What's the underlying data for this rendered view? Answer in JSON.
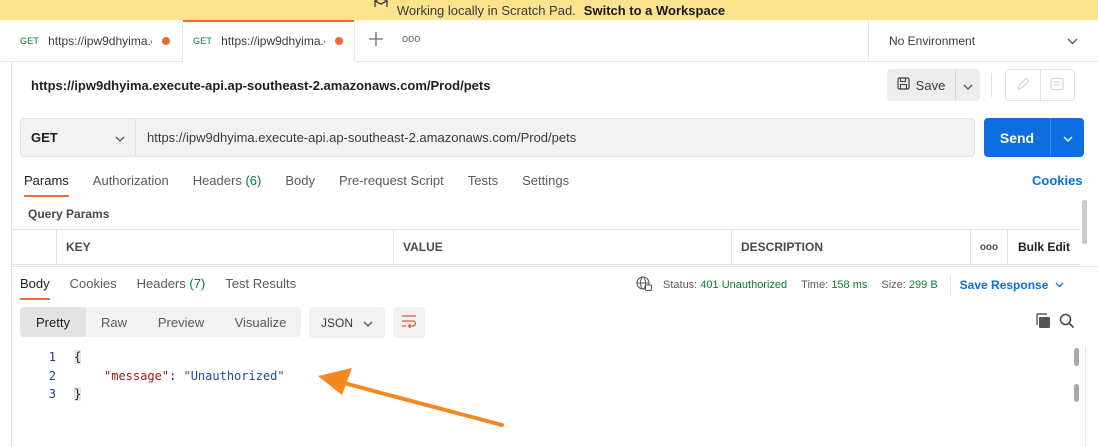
{
  "banner": {
    "text": "Working locally in Scratch Pad.",
    "link": "Switch to a Workspace"
  },
  "tabs": [
    {
      "method": "GET",
      "url": "https://ipw9dhyima.execute-api.ap-southeast-2.amazonaws.com/Prod/pets"
    },
    {
      "method": "GET",
      "url": "https://ipw9dhyima.execute-api.ap-southeast-2.amazonaws.com/Prod/pets"
    }
  ],
  "tab_more": "ooo",
  "environment": "No Environment",
  "request": {
    "title": "https://ipw9dhyima.execute-api.ap-southeast-2.amazonaws.com/Prod/pets",
    "save_label": "Save",
    "method": "GET",
    "url": "https://ipw9dhyima.execute-api.ap-southeast-2.amazonaws.com/Prod/pets",
    "send_label": "Send",
    "tabs": [
      {
        "label": "Params",
        "badge": ""
      },
      {
        "label": "Authorization",
        "badge": ""
      },
      {
        "label": "Headers",
        "badge": "(6)"
      },
      {
        "label": "Body",
        "badge": ""
      },
      {
        "label": "Pre-request Script",
        "badge": ""
      },
      {
        "label": "Tests",
        "badge": ""
      },
      {
        "label": "Settings",
        "badge": ""
      }
    ],
    "cookies_link": "Cookies",
    "query_params_title": "Query Params",
    "columns": [
      "KEY",
      "VALUE",
      "DESCRIPTION"
    ],
    "more": "ooo",
    "bulk_edit": "Bulk Edit"
  },
  "response": {
    "tabs": [
      {
        "label": "Body",
        "badge": ""
      },
      {
        "label": "Cookies",
        "badge": ""
      },
      {
        "label": "Headers",
        "badge": "(7)"
      },
      {
        "label": "Test Results",
        "badge": ""
      }
    ],
    "status_label": "Status:",
    "status_value": "401 Unauthorized",
    "time_label": "Time:",
    "time_value": "158 ms",
    "size_label": "Size:",
    "size_value": "299 B",
    "save_response": "Save Response",
    "formats": [
      "Pretty",
      "Raw",
      "Preview",
      "Visualize"
    ],
    "language": "JSON",
    "line_numbers": [
      "1",
      "2",
      "3"
    ],
    "code": {
      "open": "{",
      "key": "\"message\"",
      "colon": ": ",
      "value": "\"Unauthorized\"",
      "close": "}"
    }
  },
  "colors": {
    "accent": "#f26b3a",
    "primary": "#0d6ee1",
    "success": "#0a7a3a",
    "banner": "#fbe38e",
    "arrow": "#f5891f"
  }
}
